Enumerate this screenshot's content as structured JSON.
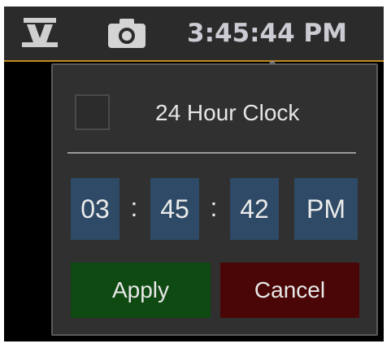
{
  "topbar": {
    "icons": [
      "app-logo-icon",
      "camera-icon"
    ],
    "clock_text": "3:45:44 PM",
    "accent_color": "#c08a1e"
  },
  "popup": {
    "checkbox_checked": false,
    "checkbox_label": "24 Hour Clock",
    "hours": "03",
    "minutes": "45",
    "seconds": "42",
    "separator": ":",
    "ampm": "PM",
    "apply_label": "Apply",
    "cancel_label": "Cancel",
    "apply_color": "#0e4a12",
    "cancel_color": "#4a0606",
    "field_color": "#2e4a66"
  }
}
